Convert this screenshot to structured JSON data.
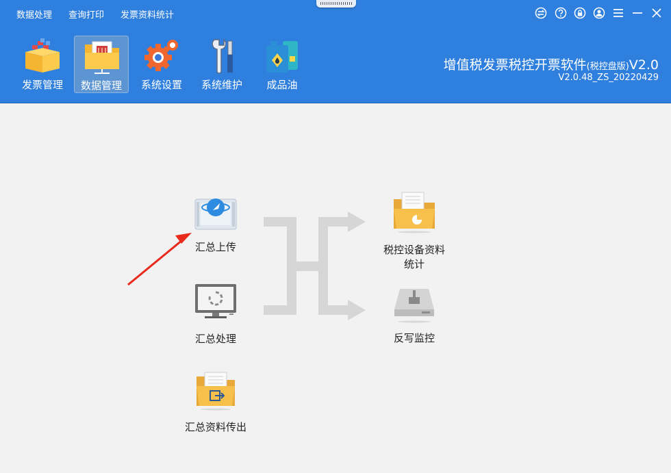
{
  "menu": [
    "数据处理",
    "查询打印",
    "发票资料统计"
  ],
  "window_controls": [
    "swap-icon",
    "help-icon",
    "lock-icon",
    "user-icon",
    "menu-icon",
    "minimize-icon",
    "close-icon"
  ],
  "toolbar": [
    {
      "label": "发票管理",
      "icon": "invoice-box-icon",
      "active": false
    },
    {
      "label": "数据管理",
      "icon": "data-folder-icon",
      "active": true
    },
    {
      "label": "系统设置",
      "icon": "gear-settings-icon",
      "active": false
    },
    {
      "label": "系统维护",
      "icon": "tools-icon",
      "active": false
    },
    {
      "label": "成品油",
      "icon": "oil-can-icon",
      "active": false
    }
  ],
  "app": {
    "title": "增值税发票税控开票软件",
    "edition": "(税控盘版)",
    "version_suffix": "V2.0",
    "version": "V2.0.48_ZS_20220429"
  },
  "nodes": {
    "summary_upload": "汇总上传",
    "summary_process": "汇总处理",
    "summary_export": "汇总资料传出",
    "device_stats_line1": "税控设备资料",
    "device_stats_line2": "统计",
    "write_back": "反写监控"
  },
  "colors": {
    "header": "#2f7fdf",
    "arrow_annotation": "#e8291c",
    "flow_arrows": "#d6d6d6"
  }
}
